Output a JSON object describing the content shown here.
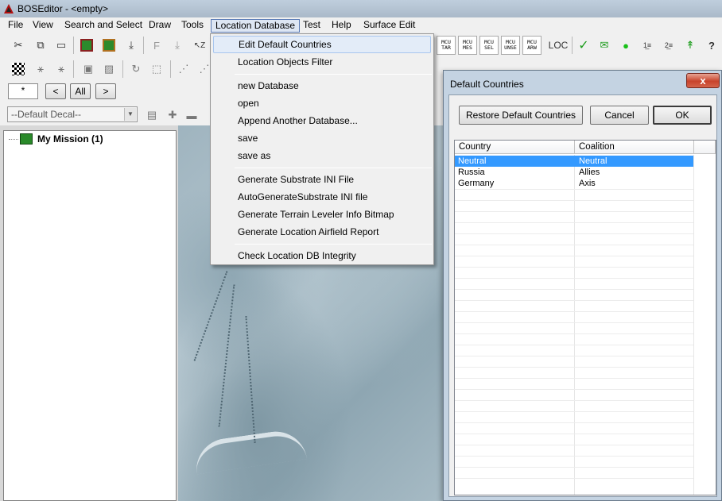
{
  "window": {
    "title": "BOSEditor - <empty>",
    "app_icon": "bos-triangle-icon"
  },
  "menubar": {
    "items": [
      "File",
      "View",
      "Search and Select",
      "Draw",
      "Tools",
      "Location Database",
      "Test",
      "Help",
      "Surface Edit"
    ],
    "active": "Location Database"
  },
  "toolbar": {
    "mcu_buttons": [
      {
        "line1": "MCU",
        "line2": "TAR"
      },
      {
        "line1": "MCU",
        "line2": "MES"
      },
      {
        "line1": "MCU",
        "line2": "SEL"
      },
      {
        "line1": "MCU",
        "line2": "UNSE"
      },
      {
        "line1": "MCU",
        "line2": "ARW"
      }
    ],
    "loc_label": "LOC",
    "page_field": "*",
    "prev_label": "<",
    "all_label": "All",
    "next_label": ">",
    "decal_select": "--Default Decal--"
  },
  "tree": {
    "root_label": "My Mission (1)"
  },
  "dropdown": {
    "items": [
      "Edit Default Countries",
      "Location Objects Filter",
      "new Database",
      "open",
      "Append Another Database...",
      "save",
      "save as",
      "Generate Substrate INI File",
      "AutoGenerateSubstrate INI file",
      "Generate Terrain Leveler Info Bitmap",
      "Generate Location Airfield Report",
      "Check Location DB Integrity"
    ],
    "highlighted": "Edit Default Countries"
  },
  "dialog": {
    "title": "Default Countries",
    "close_label": "x",
    "restore_label": "Restore Default Countries",
    "cancel_label": "Cancel",
    "ok_label": "OK",
    "columns": [
      "Country",
      "Coalition"
    ],
    "rows": [
      {
        "country": "Neutral",
        "coalition": "Neutral"
      },
      {
        "country": "Russia",
        "coalition": "Allies"
      },
      {
        "country": "Germany",
        "coalition": "Axis"
      }
    ],
    "selected_row": "Neutral"
  },
  "colors": {
    "selection": "#3399ff",
    "menu_highlight": "#e3ecf8",
    "close_button": "#c8432b"
  }
}
